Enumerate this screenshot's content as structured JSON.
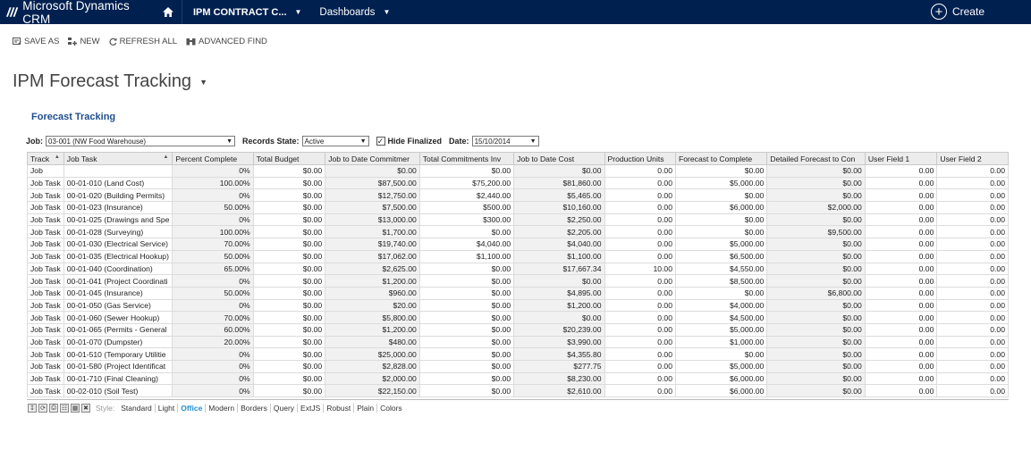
{
  "app": {
    "title": "Microsoft Dynamics CRM"
  },
  "nav": {
    "entity": "IPM CONTRACT C...",
    "area": "Dashboards",
    "create": "Create"
  },
  "commands": {
    "save_as": "SAVE AS",
    "new": "NEW",
    "refresh_all": "REFRESH ALL",
    "advanced_find": "ADVANCED FIND"
  },
  "page": {
    "title": "IPM Forecast Tracking",
    "section": "Forecast Tracking"
  },
  "filters": {
    "job_label": "Job:",
    "job_value": "03-001 (NW Food Warehouse)",
    "records_state_label": "Records State:",
    "records_state_value": "Active",
    "hide_finalized_label": "Hide Finalized",
    "hide_finalized_checked": "✓",
    "date_label": "Date:",
    "date_value": "15/10/2014"
  },
  "grid": {
    "columns": [
      "Track",
      "Job Task",
      "Percent Complete",
      "Total Budget",
      "Job to Date Commitmer",
      "Total Commitments Inv",
      "Job to Date Cost",
      "Production Units",
      "Forecast to Complete",
      "Detailed Forecast to Con",
      "User Field 1",
      "User Field 2"
    ],
    "rows": [
      [
        "Job",
        "",
        "0%",
        "$0.00",
        "$0.00",
        "$0.00",
        "$0.00",
        "0.00",
        "$0.00",
        "$0.00",
        "0.00",
        "0.00"
      ],
      [
        "Job Task",
        "00-01-010 (Land Cost)",
        "100.00%",
        "$0.00",
        "$87,500.00",
        "$75,200.00",
        "$81,860.00",
        "0.00",
        "$5,000.00",
        "$0.00",
        "0.00",
        "0.00"
      ],
      [
        "Job Task",
        "00-01-020 (Building Permits)",
        "0%",
        "$0.00",
        "$12,750.00",
        "$2,440.00",
        "$5,465.00",
        "0.00",
        "$0.00",
        "$0.00",
        "0.00",
        "0.00"
      ],
      [
        "Job Task",
        "00-01-023 (Insurance)",
        "50.00%",
        "$0.00",
        "$7,500.00",
        "$500.00",
        "$10,160.00",
        "0.00",
        "$6,000.00",
        "$2,000.00",
        "0.00",
        "0.00"
      ],
      [
        "Job Task",
        "00-01-025 (Drawings and Spe",
        "0%",
        "$0.00",
        "$13,000.00",
        "$300.00",
        "$2,250.00",
        "0.00",
        "$0.00",
        "$0.00",
        "0.00",
        "0.00"
      ],
      [
        "Job Task",
        "00-01-028 (Surveying)",
        "100.00%",
        "$0.00",
        "$1,700.00",
        "$0.00",
        "$2,205.00",
        "0.00",
        "$0.00",
        "$9,500.00",
        "0.00",
        "0.00"
      ],
      [
        "Job Task",
        "00-01-030 (Electrical Service)",
        "70.00%",
        "$0.00",
        "$19,740.00",
        "$4,040.00",
        "$4,040.00",
        "0.00",
        "$5,000.00",
        "$0.00",
        "0.00",
        "0.00"
      ],
      [
        "Job Task",
        "00-01-035 (Electrical Hookup)",
        "50.00%",
        "$0.00",
        "$17,062.00",
        "$1,100.00",
        "$1,100.00",
        "0.00",
        "$6,500.00",
        "$0.00",
        "0.00",
        "0.00"
      ],
      [
        "Job Task",
        "00-01-040 (Coordination)",
        "65.00%",
        "$0.00",
        "$2,625.00",
        "$0.00",
        "$17,667.34",
        "10.00",
        "$4,550.00",
        "$0.00",
        "0.00",
        "0.00"
      ],
      [
        "Job Task",
        "00-01-041 (Project Coordinati",
        "0%",
        "$0.00",
        "$1,200.00",
        "$0.00",
        "$0.00",
        "0.00",
        "$8,500.00",
        "$0.00",
        "0.00",
        "0.00"
      ],
      [
        "Job Task",
        "00-01-045 (Insurance)",
        "50.00%",
        "$0.00",
        "$960.00",
        "$0.00",
        "$4,895.00",
        "0.00",
        "$0.00",
        "$6,800.00",
        "0.00",
        "0.00"
      ],
      [
        "Job Task",
        "00-01-050 (Gas Service)",
        "0%",
        "$0.00",
        "$20.00",
        "$0.00",
        "$1,200.00",
        "0.00",
        "$4,000.00",
        "$0.00",
        "0.00",
        "0.00"
      ],
      [
        "Job Task",
        "00-01-060 (Sewer Hookup)",
        "70.00%",
        "$0.00",
        "$5,800.00",
        "$0.00",
        "$0.00",
        "0.00",
        "$4,500.00",
        "$0.00",
        "0.00",
        "0.00"
      ],
      [
        "Job Task",
        "00-01-065 (Permits - General",
        "60.00%",
        "$0.00",
        "$1,200.00",
        "$0.00",
        "$20,239.00",
        "0.00",
        "$5,000.00",
        "$0.00",
        "0.00",
        "0.00"
      ],
      [
        "Job Task",
        "00-01-070 (Dumpster)",
        "20.00%",
        "$0.00",
        "$480.00",
        "$0.00",
        "$3,990.00",
        "0.00",
        "$1,000.00",
        "$0.00",
        "0.00",
        "0.00"
      ],
      [
        "Job Task",
        "00-01-510 (Temporary Utilitie",
        "0%",
        "$0.00",
        "$25,000.00",
        "$0.00",
        "$4,355.80",
        "0.00",
        "$0.00",
        "$0.00",
        "0.00",
        "0.00"
      ],
      [
        "Job Task",
        "00-01-580 (Project Identificat",
        "0%",
        "$0.00",
        "$2,828.00",
        "$0.00",
        "$277.75",
        "0.00",
        "$5,000.00",
        "$0.00",
        "0.00",
        "0.00"
      ],
      [
        "Job Task",
        "00-01-710 (Final Cleaning)",
        "0%",
        "$0.00",
        "$2,000.00",
        "$0.00",
        "$8,230.00",
        "0.00",
        "$6,000.00",
        "$0.00",
        "0.00",
        "0.00"
      ],
      [
        "Job Task",
        "00-02-010 (Soil Test)",
        "0%",
        "$0.00",
        "$22,150.00",
        "$0.00",
        "$2,610.00",
        "0.00",
        "$6,000.00",
        "$0.00",
        "0.00",
        "0.00"
      ]
    ]
  },
  "footer": {
    "style_label": "Style:",
    "styles": [
      "Standard",
      "Light",
      "Office",
      "Modern",
      "Borders",
      "Query",
      "ExtJS",
      "Robust",
      "Plain",
      "Colors"
    ],
    "active_style": "Office"
  },
  "colors": {
    "topbar": "#002050",
    "accent": "#1f4e8c",
    "active_style": "#1e8fd6"
  }
}
